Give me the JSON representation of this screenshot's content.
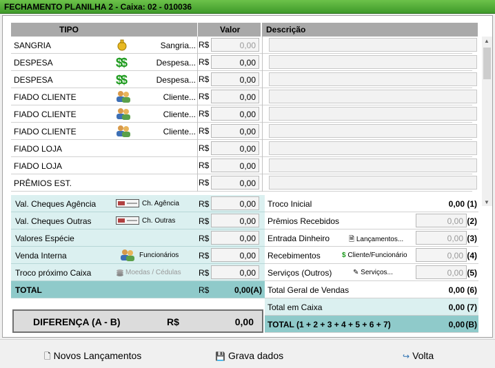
{
  "window": {
    "title": "FECHAMENTO PLANILHA 2 - Caixa: 02 - 010036"
  },
  "grid": {
    "headers": {
      "tipo": "TIPO",
      "valor": "Valor",
      "descricao": "Descrição"
    },
    "rows": [
      {
        "tipo": "SANGRIA",
        "icon": "moneybag-icon",
        "label": "Sangria...",
        "currency": "R$",
        "value": "0,00",
        "value_gray": true
      },
      {
        "tipo": "DESPESA",
        "icon": "dollar-icon",
        "label": "Despesa...",
        "currency": "R$",
        "value": "0,00",
        "value_gray": false
      },
      {
        "tipo": "DESPESA",
        "icon": "dollar-icon",
        "label": "Despesa...",
        "currency": "R$",
        "value": "0,00",
        "value_gray": false
      },
      {
        "tipo": "FIADO CLIENTE",
        "icon": "users-icon",
        "label": "Cliente...",
        "currency": "R$",
        "value": "0,00",
        "value_gray": false
      },
      {
        "tipo": "FIADO CLIENTE",
        "icon": "users-icon",
        "label": "Cliente...",
        "currency": "R$",
        "value": "0,00",
        "value_gray": false
      },
      {
        "tipo": "FIADO CLIENTE",
        "icon": "users-icon",
        "label": "Cliente...",
        "currency": "R$",
        "value": "0,00",
        "value_gray": false
      },
      {
        "tipo": "FIADO LOJA",
        "icon": "",
        "label": "",
        "currency": "R$",
        "value": "0,00",
        "value_gray": false
      },
      {
        "tipo": "FIADO LOJA",
        "icon": "",
        "label": "",
        "currency": "R$",
        "value": "0,00",
        "value_gray": false
      },
      {
        "tipo": "PRÊMIOS EST.",
        "icon": "",
        "label": "",
        "currency": "R$",
        "value": "0,00",
        "value_gray": false
      }
    ]
  },
  "left_summary": [
    {
      "label": "Val. Cheques Agência",
      "icon": "cheque-icon",
      "action": "Ch. Agência",
      "currency": "R$",
      "value": "0,00"
    },
    {
      "label": "Val. Cheques Outras",
      "icon": "cheque-icon",
      "action": "Ch. Outras",
      "currency": "R$",
      "value": "0,00"
    },
    {
      "label": "Valores Espécie",
      "icon": "",
      "action": "",
      "currency": "R$",
      "value": "0,00"
    },
    {
      "label": "Venda Interna",
      "icon": "users-icon",
      "action": "Funcionários",
      "currency": "R$",
      "value": "0,00"
    },
    {
      "label": "Troco próximo Caixa",
      "icon": "coins-icon",
      "action": "Moedas / Cédulas",
      "currency": "R$",
      "value": "0,00"
    }
  ],
  "left_total": {
    "label": "TOTAL",
    "currency": "R$",
    "value": "0,00(A)"
  },
  "right_summary": [
    {
      "label": "Troco Inicial",
      "action": "",
      "value": "0,00",
      "num": "(1)",
      "input": false
    },
    {
      "label": "Prêmios Recebidos",
      "action": "",
      "value": "0,00",
      "num": "(2)",
      "input": true
    },
    {
      "label": "Entrada Dinheiro",
      "action": "Lançamentos...",
      "value": "0,00",
      "num": "(3)",
      "input": true
    },
    {
      "label": "Recebimentos",
      "action": "Cliente/Funcionário",
      "value": "0,00",
      "num": "(4)",
      "input": true
    },
    {
      "label": "Serviços (Outros)",
      "action": "Serviços...",
      "value": "0,00",
      "num": "(5)",
      "input": true
    },
    {
      "label": "Total Geral de Vendas",
      "action": "",
      "value": "0,00",
      "num": "(6)",
      "input": false
    },
    {
      "label": "Total em Caixa",
      "action": "",
      "value": "0,00",
      "num": "(7)",
      "input": false
    }
  ],
  "right_total": {
    "label": "TOTAL (1 + 2  + 3 + 4 + 5 + 6 + 7)",
    "value": "0,00",
    "num": "(B)"
  },
  "difference": {
    "label": "DIFERENÇA (A - B)",
    "currency": "R$",
    "value": "0,00"
  },
  "buttons": {
    "novos": "Novos Lançamentos",
    "gravar": "Grava dados",
    "volta": "Volta"
  },
  "colors": {
    "title_bar": "#4fae33",
    "summary_bg": "#dbf0f0",
    "total_bg": "#8fcaca",
    "header_bg": "#a9a9a9"
  }
}
